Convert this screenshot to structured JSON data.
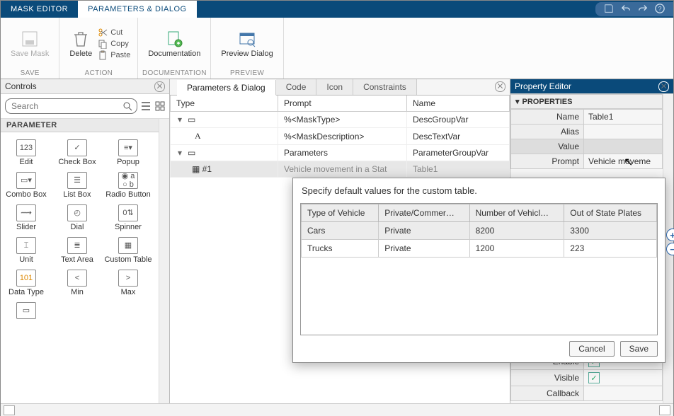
{
  "titlebar": {
    "tabs": [
      "MASK EDITOR",
      "PARAMETERS & DIALOG"
    ],
    "active_tab": 1
  },
  "toolbar": {
    "groups": {
      "save": {
        "label": "SAVE",
        "save_mask": "Save Mask"
      },
      "action": {
        "label": "ACTION",
        "delete": "Delete",
        "cut": "Cut",
        "copy": "Copy",
        "paste": "Paste"
      },
      "documentation": {
        "label": "DOCUMENTATION",
        "btn": "Documentation"
      },
      "preview": {
        "label": "PREVIEW",
        "btn": "Preview Dialog"
      }
    }
  },
  "left_panel": {
    "title": "Controls",
    "search_placeholder": "Search",
    "section": "PARAMETER",
    "items": [
      [
        "Edit",
        "Check Box",
        "Popup"
      ],
      [
        "Combo Box",
        "List Box",
        "Radio Button"
      ],
      [
        "Slider",
        "Dial",
        "Spinner"
      ],
      [
        "Unit",
        "Text Area",
        "Custom Table"
      ],
      [
        "Data Type",
        "Min",
        "Max"
      ]
    ]
  },
  "center": {
    "tabs": [
      "Parameters & Dialog",
      "Code",
      "Icon",
      "Constraints"
    ],
    "active_tab": 0,
    "columns": [
      "Type",
      "Prompt",
      "Name"
    ],
    "rows": [
      {
        "type": "",
        "prompt": "%<MaskType>",
        "name": "DescGroupVar",
        "indent": 0,
        "expand": true
      },
      {
        "type": "A",
        "prompt": "%<MaskDescription>",
        "name": "DescTextVar",
        "indent": 1
      },
      {
        "type": "",
        "prompt": "Parameters",
        "name": "ParameterGroupVar",
        "indent": 0,
        "expand": true
      },
      {
        "type": "#1",
        "prompt": "Vehicle movement in a Stat",
        "name": "Table1",
        "indent": 1,
        "selected": true
      }
    ]
  },
  "right": {
    "title": "Property Editor",
    "section": "PROPERTIES",
    "rows": [
      {
        "k": "Name",
        "v": "Table1"
      },
      {
        "k": "Alias",
        "v": ""
      },
      {
        "k": "Value",
        "v": "",
        "selected": true
      },
      {
        "k": "Prompt",
        "v": "Vehicle moveme"
      }
    ],
    "bottom_rows": [
      {
        "k": "Enable",
        "checked": true
      },
      {
        "k": "Visible",
        "checked": true
      },
      {
        "k": "Callback",
        "v": ""
      }
    ]
  },
  "popup": {
    "message": "Specify default values for the custom table.",
    "headers": [
      "Type of Vehicle",
      "Private/Commer…",
      "Number of Vehicl…",
      "Out of State Plates"
    ],
    "rows": [
      [
        "Cars",
        "Private",
        "8200",
        "3300"
      ],
      [
        "Trucks",
        "Private",
        "1200",
        "223"
      ]
    ],
    "cancel": "Cancel",
    "save": "Save"
  }
}
